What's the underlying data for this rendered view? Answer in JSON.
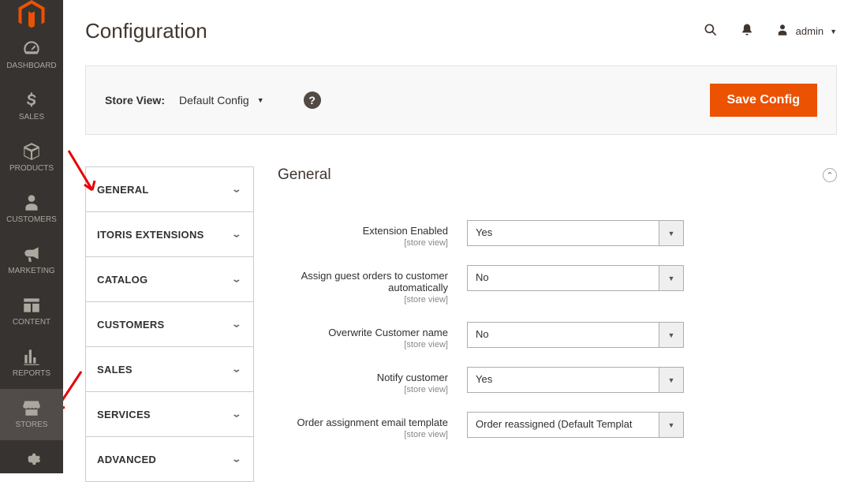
{
  "sidebar": {
    "items": [
      {
        "label": "DASHBOARD"
      },
      {
        "label": "SALES"
      },
      {
        "label": "PRODUCTS"
      },
      {
        "label": "CUSTOMERS"
      },
      {
        "label": "MARKETING"
      },
      {
        "label": "CONTENT"
      },
      {
        "label": "REPORTS"
      },
      {
        "label": "STORES"
      }
    ]
  },
  "header": {
    "page_title": "Configuration",
    "admin_username": "admin"
  },
  "scope": {
    "label": "Store View:",
    "value": "Default Config",
    "save_button": "Save Config"
  },
  "config_tabs": [
    "GENERAL",
    "ITORIS EXTENSIONS",
    "CATALOG",
    "CUSTOMERS",
    "SALES",
    "SERVICES",
    "ADVANCED"
  ],
  "section": {
    "title": "General",
    "scope_hint": "[store view]"
  },
  "fields": [
    {
      "label": "Extension Enabled",
      "value": "Yes"
    },
    {
      "label": "Assign guest orders to customer automatically",
      "value": "No"
    },
    {
      "label": "Overwrite Customer name",
      "value": "No"
    },
    {
      "label": "Notify customer",
      "value": "Yes"
    },
    {
      "label": "Order assignment email template",
      "value": "Order reassigned (Default Templat"
    }
  ]
}
